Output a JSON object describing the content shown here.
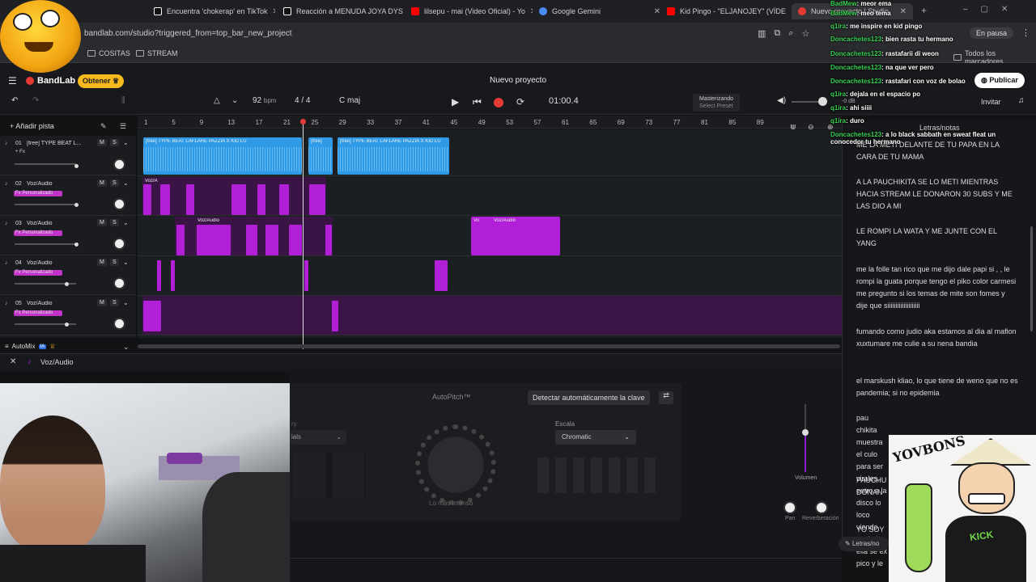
{
  "browser": {
    "tabs": [
      {
        "title": "Encuentra 'chokerap' en TikTok",
        "color": "#111111"
      },
      {
        "title": "Reacción a MENUDA JOYA DYS",
        "color": "#111111"
      },
      {
        "title": "lilsepu - mai (Video Oficial) - Yo",
        "color": "#ff0000"
      },
      {
        "title": "Google Gemini",
        "color": "#4a8cf7"
      },
      {
        "title": "Kid Pingo - \"ELJANOJEY\" (VÍDE",
        "color": "#ff0000"
      },
      {
        "title": "Nuevo proyecto | Studio",
        "color": "#e53935"
      }
    ],
    "url": "bandlab.com/studio?triggered_from=top_bar_new_project",
    "bookmarks": [
      "COSITAS",
      "STREAM"
    ],
    "all_bookmarks": "Todos los marcadores",
    "paused": "En pausa"
  },
  "header": {
    "brand": "BandLab",
    "get_pro": "Obtener",
    "project_title": "Nuevo proyecto",
    "publish": "Publicar",
    "invite": "Invitar"
  },
  "transport": {
    "bpm": "92",
    "bpm_unit": "bpm",
    "time_sig": "4 / 4",
    "key": "C maj",
    "time": "01:00.4",
    "mastering": "Masterizando",
    "select_preset": "Select Preset"
  },
  "add_track": "Añadir pista",
  "ruler": [
    "1",
    "5",
    "9",
    "13",
    "17",
    "21",
    "25",
    "29",
    "33",
    "37",
    "41",
    "45",
    "49",
    "53",
    "57",
    "61",
    "65",
    "69",
    "73",
    "77",
    "81",
    "85",
    "89"
  ],
  "tracks": [
    {
      "num": "01",
      "name": "[free] TYPE BEAT L...",
      "fx": "+ Fx"
    },
    {
      "num": "02",
      "name": "Voz/Audio",
      "fx": "Fx Personalizado"
    },
    {
      "num": "03",
      "name": "Voz/Audio",
      "fx": "Fx Personalizado"
    },
    {
      "num": "04",
      "name": "Voz/Audio",
      "fx": "Fx Personalizado"
    },
    {
      "num": "05",
      "name": "Voz/Audio",
      "fx": "Fx Personalizado"
    }
  ],
  "clips": {
    "beat1": "[free] TYPE BEAT LAFLARE PAZZIA X KID LU",
    "beat2": "[free]",
    "beat3": "[free] TYPE BEAT LAFLARE PAZZIA X KID LU",
    "voz_short": "Voz/A",
    "voz": "Voz/Audio",
    "vo": "Vo"
  },
  "automix": "AutoMix",
  "automix_badge": "IA",
  "mute": "M",
  "solo": "S",
  "bottom_panel": {
    "track": "Voz/Audio",
    "effect": "AutoPitch™",
    "detect_key": "Detectar automáticamente la clave",
    "scale_label": "Escala",
    "scale": "Chromatic",
    "dial_label": "Lo más intenso",
    "volume": "Volumen",
    "pan": "Pan",
    "reverb": "Reverberación",
    "presets_label": "ry",
    "presets_value": "ials"
  },
  "lyrics_panel": {
    "title": "Letras/notas",
    "footer": "Letras/no",
    "paragraphs": [
      "ME LA METI DELANTE DE TU PAPA EN LA CARA DE TU MAMA",
      "A LA PAUCHIKITA SE LO METI MIENTRAS HACIA STREAM LE DONARON 30 SUBS Y ME LAS DIO A MI",
      "LE ROMPI LA WATA Y ME JUNTE CON EL YANG",
      "me la folle tan rico que me dijo dale papi si , , le rompi la guata porque tengo el piko color carmesi  me pregunto si los temas de mite son fomes y dije que siiiiiiiiiiiiiiiiiiii",
      "fumando como judio aka estamos al dia al mafion xuxtumare me culie a su nena bandia",
      "el marskush kliao, lo que tiene de weno que no es pandemia; si no epidemia",
      "pau chikita muestra el culo para ser virales, entro a la disco lo loco viendo espirales, ella se ex pico y le",
      "PAUCHU DONAN",
      "YO SOY"
    ]
  },
  "chat": [
    {
      "user": "BadMew",
      "msg": "meor ema"
    },
    {
      "user": "BadMew",
      "msg": "meo tema"
    },
    {
      "user": "q1ira",
      "msg": "me inspire en kid pingo"
    },
    {
      "user": "Doncachetes123",
      "msg": "bien rasta tu hermano"
    },
    {
      "user": "Doncachetes123",
      "msg": "rastafarii di weon"
    },
    {
      "user": "Doncachetes123",
      "msg": "na que ver pero"
    },
    {
      "user": "Doncachetes123",
      "msg": "rastafari con voz de bolao"
    },
    {
      "user": "q1ira",
      "msg": "dejala en el espacio po"
    },
    {
      "user": "q1ira",
      "msg": "ahi siiii"
    },
    {
      "user": "q1ira",
      "msg": "duro"
    },
    {
      "user": "Doncachetes123",
      "msg": "a lo black sabbath en sweat fleat un conocedor tu hermano"
    }
  ],
  "master_db": "-0 dB",
  "sticker_text": "KICK",
  "sticker_logo": "YOVBONS",
  "colors": {
    "accent": "#e53935",
    "beat_clip": "#2f9be6",
    "voice_clip": "#b11fd6",
    "publish_bg": "#ffffff"
  }
}
